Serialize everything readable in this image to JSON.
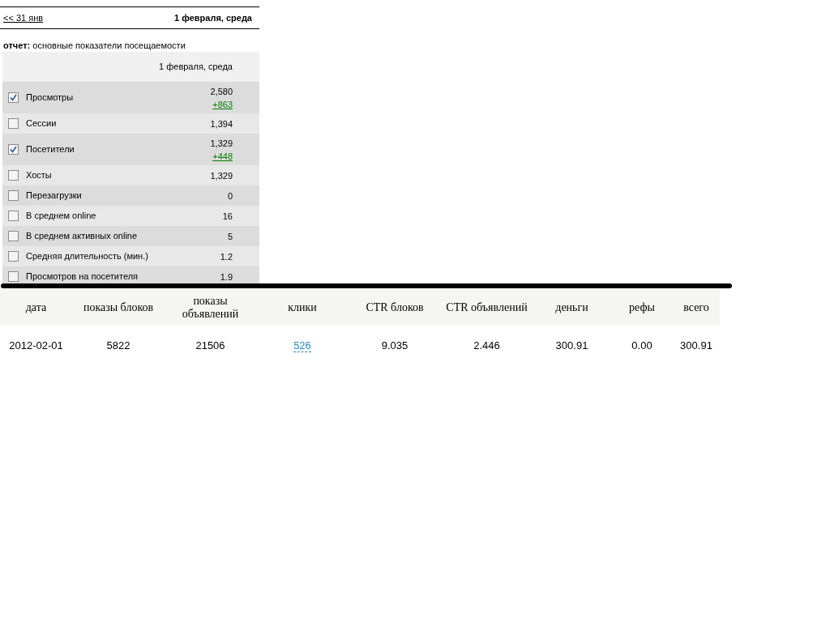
{
  "nav": {
    "prev_link": "<< 31 янв",
    "current_date": "1 февраля, среда"
  },
  "report": {
    "label": "отчет:",
    "title": "основные показатели посещаемости",
    "column_header": "1 февраля, среда",
    "rows": [
      {
        "label": "Просмотры",
        "checked": true,
        "value": "2,580",
        "delta": "+863"
      },
      {
        "label": "Сессии",
        "checked": false,
        "value": "1,394"
      },
      {
        "label": "Посетители",
        "checked": true,
        "value": "1,329",
        "delta": "+448"
      },
      {
        "label": "Хосты",
        "checked": false,
        "value": "1,329"
      },
      {
        "label": "Перезагрузки",
        "checked": false,
        "value": "0"
      },
      {
        "label": "В среднем online",
        "checked": false,
        "value": "16"
      },
      {
        "label": "В среднем активных online",
        "checked": false,
        "value": "5"
      },
      {
        "label": "Средняя длительность (мин.)",
        "checked": false,
        "value": "1.2"
      },
      {
        "label": "Просмотров на посетителя",
        "checked": false,
        "value": "1.9"
      }
    ]
  },
  "stats_table": {
    "columns": [
      "дата",
      "показы блоков",
      "показы объявлений",
      "клики",
      "CTR блоков",
      "CTR объявлений",
      "деньги",
      "рефы",
      "всего"
    ],
    "rows": [
      [
        {
          "text": "2012-02-01",
          "kind": "text"
        },
        {
          "text": "5822",
          "kind": "text"
        },
        {
          "text": "21506",
          "kind": "text"
        },
        {
          "text": "526",
          "kind": "link"
        },
        {
          "text": "9.035",
          "kind": "text"
        },
        {
          "text": "2.446",
          "kind": "text"
        },
        {
          "text": "300.91",
          "kind": "text"
        },
        {
          "text": "0.00",
          "kind": "text"
        },
        {
          "text": "300.91",
          "kind": "text"
        }
      ]
    ]
  }
}
